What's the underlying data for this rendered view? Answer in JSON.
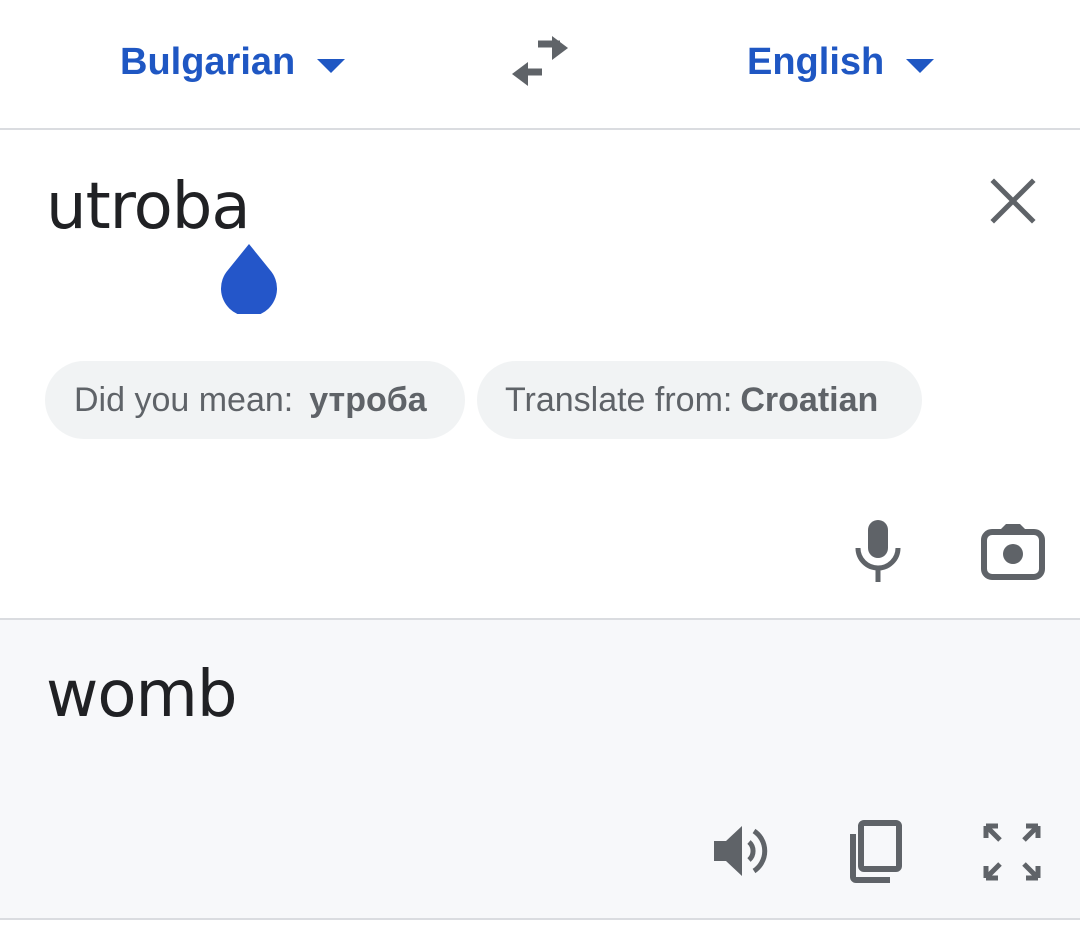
{
  "language_bar": {
    "source_language": "Bulgarian",
    "target_language": "English",
    "icons": {
      "caret": "caret-down-icon",
      "swap": "swap-arrows-icon"
    }
  },
  "input": {
    "source_text": "utroba",
    "suggestions": {
      "did_you_mean_label": "Did you mean:",
      "did_you_mean_value": "утроба",
      "translate_from_label": "Translate from:",
      "translate_from_value": "Croatian"
    },
    "icons": {
      "clear": "close-icon",
      "mic": "microphone-icon",
      "camera": "camera-icon"
    }
  },
  "output": {
    "translated_text": "womb",
    "icons": {
      "speak": "speaker-icon",
      "copy": "copy-icon",
      "fullscreen": "fullscreen-icon"
    }
  },
  "colors": {
    "accent": "#1f57c3",
    "cursor_handle": "#2456c9",
    "icon_gray": "#5f6368",
    "chip_bg": "#f1f3f4",
    "output_bg": "#f7f8fa",
    "divider": "#dadce0",
    "text": "#202124"
  }
}
